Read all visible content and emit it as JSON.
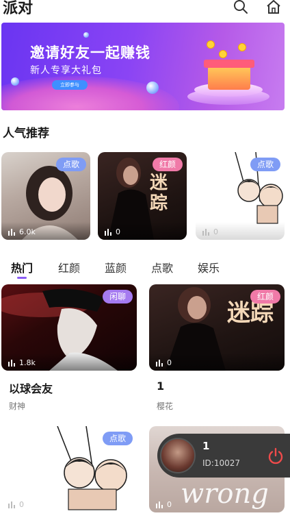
{
  "header": {
    "title": "派对",
    "search_icon": "search-icon",
    "home_icon": "home-icon"
  },
  "banner": {
    "headline": "邀请好友一起赚钱",
    "subline": "新人专享大礼包",
    "cta": "立即参与"
  },
  "popular": {
    "title": "人气推荐",
    "cards": [
      {
        "badge": "点歌",
        "count": "6.0k"
      },
      {
        "badge": "红颜",
        "count": "0"
      },
      {
        "badge": "点歌",
        "count": "0"
      }
    ]
  },
  "tabs": [
    "热门",
    "红颜",
    "蓝颜",
    "点歌",
    "娱乐"
  ],
  "rooms": [
    {
      "badge": "闲聊",
      "count": "1.8k",
      "title": "以球会友",
      "subtitle": "财神"
    },
    {
      "badge": "红颜",
      "count": "0",
      "title": "1",
      "subtitle": "樱花"
    },
    {
      "badge": "点歌",
      "count": "0"
    },
    {
      "badge": "",
      "count": "0"
    }
  ],
  "art_text": {
    "mizong": "迷踪",
    "wrong": "wrong"
  },
  "miniplayer": {
    "title": "1",
    "id": "ID:10027"
  },
  "colors": {
    "accent": "#8a5cf5",
    "badge_blue": "#7f9cf5",
    "badge_pink": "#f07aa8",
    "badge_purple": "#a57af0",
    "power": "#f04b4b"
  }
}
